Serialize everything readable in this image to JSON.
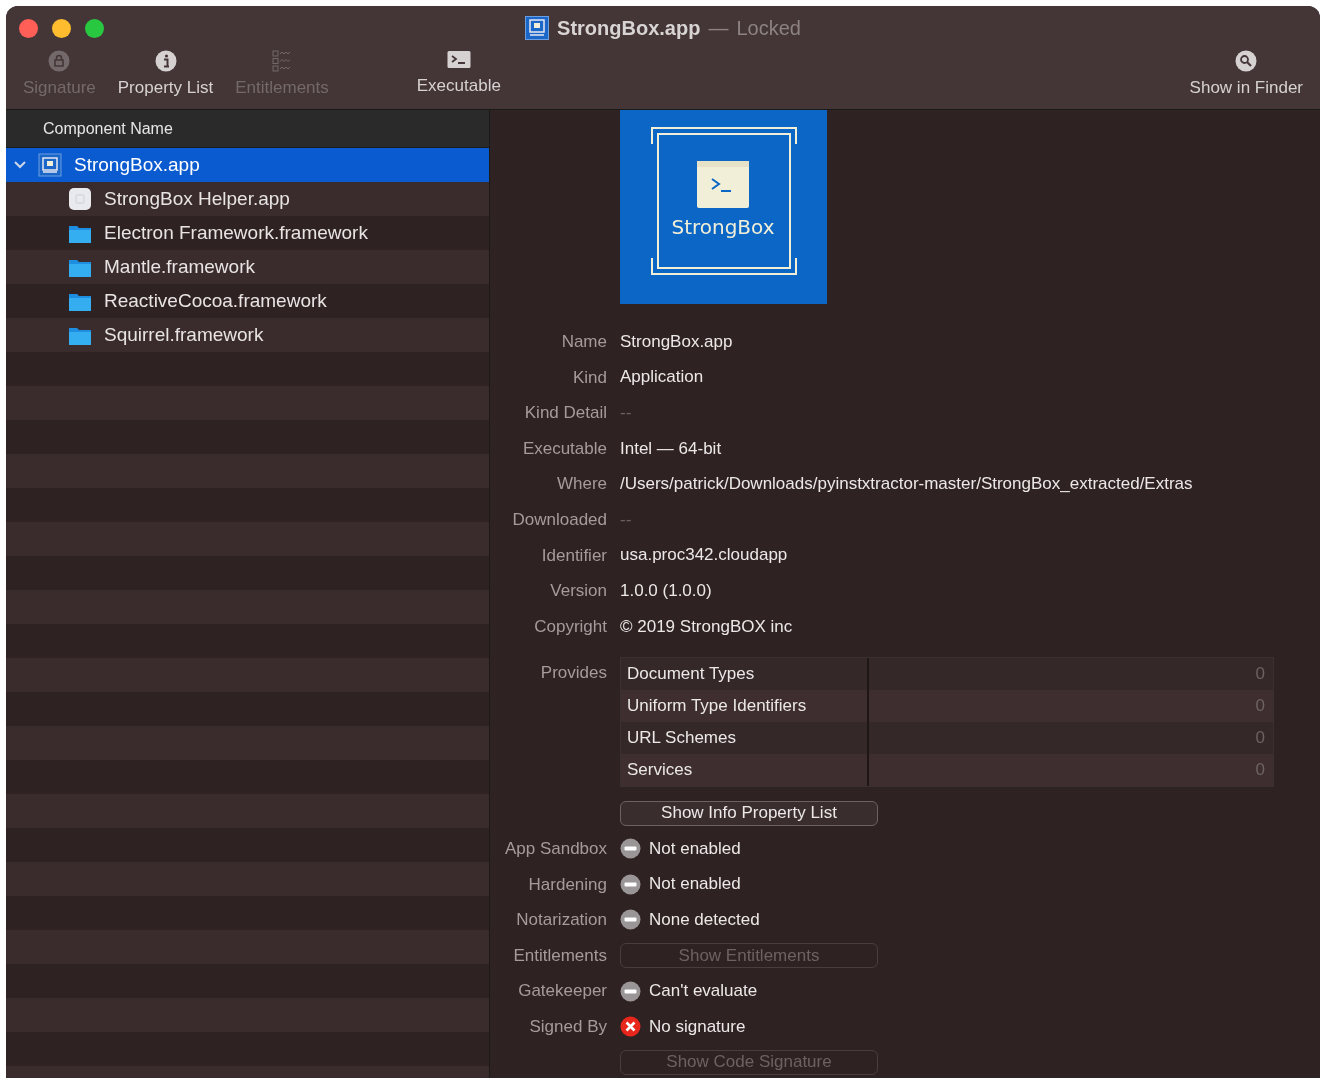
{
  "window": {
    "title": "StrongBox.app",
    "separator": "—",
    "subtitle": "Locked"
  },
  "toolbar": {
    "groups": [
      {
        "items": [
          {
            "label": "Signature",
            "kind": "lock",
            "disabled": true
          },
          {
            "label": "Property List",
            "kind": "info",
            "disabled": false
          },
          {
            "label": "Entitlements",
            "kind": "checklist",
            "disabled": true
          }
        ]
      },
      {
        "items": [
          {
            "label": "Executable",
            "kind": "terminal",
            "disabled": false
          }
        ]
      },
      {
        "items": [
          {
            "label": "Show in Finder",
            "kind": "search",
            "disabled": false
          }
        ]
      }
    ]
  },
  "sidebar": {
    "header": "Component Name",
    "items": [
      {
        "name": "StrongBox.app",
        "kind": "app",
        "selected": true,
        "expanded": true,
        "children": [
          {
            "name": "StrongBox Helper.app",
            "kind": "helper",
            "selected": false
          },
          {
            "name": "Electron Framework.framework",
            "kind": "folder",
            "selected": false
          },
          {
            "name": "Mantle.framework",
            "kind": "folder",
            "selected": false
          },
          {
            "name": "ReactiveCocoa.framework",
            "kind": "folder",
            "selected": false
          },
          {
            "name": "Squirrel.framework",
            "kind": "folder",
            "selected": false
          }
        ]
      }
    ]
  },
  "details": {
    "app_icon": {
      "caption": "StrongBox"
    },
    "rows": [
      {
        "kind": "text",
        "label": "Name",
        "value": "StrongBox.app",
        "dimmed": false
      },
      {
        "kind": "text",
        "label": "Kind",
        "value": "Application",
        "dimmed": false
      },
      {
        "kind": "text",
        "label": "Kind Detail",
        "value": "--",
        "dimmed": true
      },
      {
        "kind": "text",
        "label": "Executable",
        "value": "Intel — 64-bit",
        "dimmed": false
      },
      {
        "kind": "text",
        "label": "Where",
        "value": "/Users/patrick/Downloads/pyinstxtractor-master/StrongBox_extracted/Extras",
        "dimmed": false
      },
      {
        "kind": "text",
        "label": "Downloaded",
        "value": "--",
        "dimmed": true
      },
      {
        "kind": "text",
        "label": "Identifier",
        "value": "usa.proc342.cloudapp",
        "dimmed": false
      },
      {
        "kind": "text",
        "label": "Version",
        "value": "1.0.0 (1.0.0)",
        "dimmed": false
      },
      {
        "kind": "text",
        "label": "Copyright",
        "value": "© 2019 StrongBOX inc",
        "dimmed": false
      },
      {
        "kind": "table",
        "label": "Provides",
        "items": [
          {
            "name": "Document Types",
            "count": "0"
          },
          {
            "name": "Uniform Type Identifiers",
            "count": "0"
          },
          {
            "name": "URL Schemes",
            "count": "0"
          },
          {
            "name": "Services",
            "count": "0"
          }
        ]
      },
      {
        "kind": "button",
        "button": "Show Info Property List",
        "disabled": false
      },
      {
        "kind": "status",
        "label": "App Sandbox",
        "error": false,
        "value": "Not enabled"
      },
      {
        "kind": "status",
        "label": "Hardening",
        "error": false,
        "value": "Not enabled"
      },
      {
        "kind": "status",
        "label": "Notarization",
        "error": false,
        "value": "None detected"
      },
      {
        "kind": "button",
        "label": "Entitlements",
        "button": "Show Entitlements",
        "disabled": true
      },
      {
        "kind": "status",
        "label": "Gatekeeper",
        "error": false,
        "value": "Can't evaluate"
      },
      {
        "kind": "status",
        "label": "Signed By",
        "error": true,
        "value": "No signature"
      },
      {
        "kind": "button",
        "button": "Show Code Signature",
        "disabled": true
      }
    ]
  }
}
